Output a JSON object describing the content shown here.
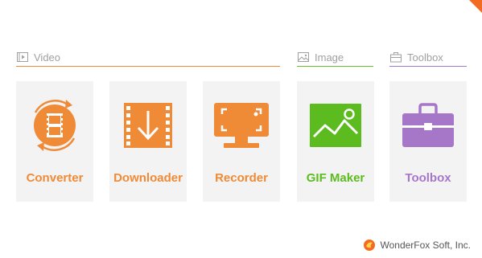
{
  "sections": {
    "video": {
      "label": "Video",
      "icon": "video-section-icon"
    },
    "image": {
      "label": "Image",
      "icon": "image-section-icon"
    },
    "toolbox": {
      "label": "Toolbox",
      "icon": "toolbox-section-icon"
    }
  },
  "tools": {
    "converter": {
      "label": "Converter",
      "icon": "converter-icon"
    },
    "downloader": {
      "label": "Downloader",
      "icon": "downloader-icon"
    },
    "recorder": {
      "label": "Recorder",
      "icon": "recorder-icon"
    },
    "gif_maker": {
      "label": "GIF Maker",
      "icon": "gif-maker-icon"
    },
    "toolbox": {
      "label": "Toolbox",
      "icon": "toolbox-icon"
    }
  },
  "footer": {
    "company": "WonderFox Soft, Inc."
  },
  "colors": {
    "orange": "#ef8a37",
    "green": "#5cbb1f",
    "purple": "#a677c9",
    "card_bg": "#f3f3f3",
    "header_text": "#a0a0a0"
  }
}
